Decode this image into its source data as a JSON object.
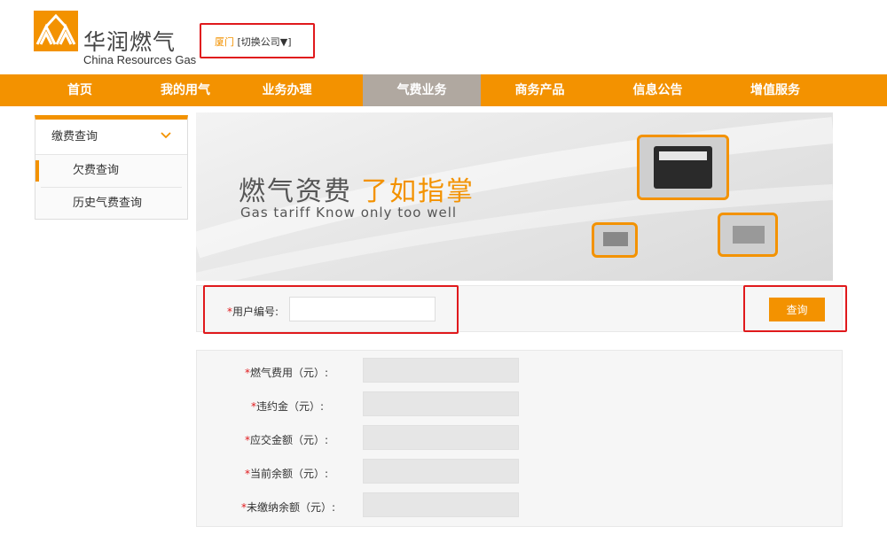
{
  "header": {
    "logo_cn": "华润燃气",
    "logo_en": "China Resources Gas",
    "city": "厦门",
    "switch_company": "[切换公司▼]"
  },
  "nav": {
    "items": [
      "首页",
      "我的用气",
      "业务办理",
      "气费业务",
      "商务产品",
      "信息公告",
      "增值服务"
    ],
    "active_index": 3
  },
  "sidebar": {
    "group_label": "缴费查询",
    "items": [
      "欠费查询",
      "历史气费查询"
    ]
  },
  "banner": {
    "title": "燃气资费",
    "title_highlight": "了如指掌",
    "subtitle": "Gas tariff   Know only too well"
  },
  "query": {
    "required_mark": "*",
    "label": "用户编号:",
    "input_value": "",
    "button": "查询"
  },
  "result": {
    "fields": [
      {
        "required_mark": "*",
        "label": "燃气费用（元）:",
        "value": ""
      },
      {
        "required_mark": "*",
        "label": "违约金（元）:",
        "value": ""
      },
      {
        "required_mark": "*",
        "label": "应交金额（元）:",
        "value": ""
      },
      {
        "required_mark": "*",
        "label": "当前余额（元）:",
        "value": ""
      },
      {
        "required_mark": "*",
        "label": "未缴纳余额（元）:",
        "value": ""
      }
    ]
  },
  "colors": {
    "brand_orange": "#f39200",
    "highlight_red": "#e0191c",
    "nav_active": "#b0a8a0"
  }
}
